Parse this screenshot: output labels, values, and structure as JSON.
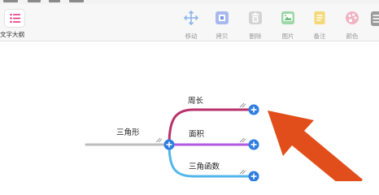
{
  "toolbar": {
    "outline": {
      "label": "文字大纲",
      "icon": "list-icon"
    },
    "items": [
      {
        "label": "移动",
        "icon": "move-icon"
      },
      {
        "label": "拷贝",
        "icon": "copy-icon"
      },
      {
        "label": "删除",
        "icon": "trash-icon"
      },
      {
        "label": "图片",
        "icon": "image-icon"
      },
      {
        "label": "备注",
        "icon": "note-icon"
      },
      {
        "label": "颜色",
        "icon": "palette-icon"
      }
    ]
  },
  "mindmap": {
    "root": {
      "label": "三角形"
    },
    "children": [
      {
        "label": "周长",
        "color": "#b8316a"
      },
      {
        "label": "面积",
        "color": "#b158e0"
      },
      {
        "label": "三角函数",
        "color": "#52b6ea"
      }
    ],
    "root_line_color": "#bdbdbd",
    "add_button_color": "#2d7de0"
  },
  "annotation": {
    "arrow_color": "#e24e1b"
  },
  "colors": {
    "accent": "#e5247c",
    "toolbar_bg": "#f7f7f7",
    "label_gray": "#9a9a9a"
  }
}
